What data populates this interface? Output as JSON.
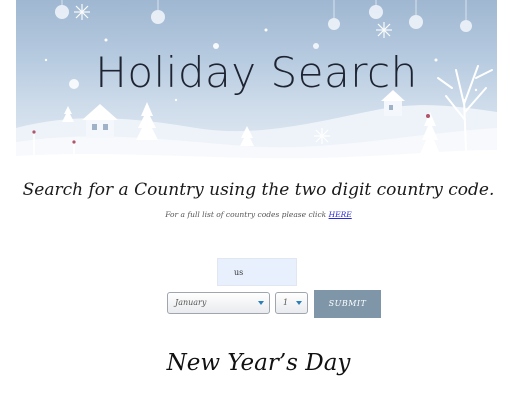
{
  "banner": {
    "title": "Holiday Search"
  },
  "search": {
    "heading": "Search for a Country using the two digit country code.",
    "hint_prefix": "For a full list of country codes please click ",
    "hint_link": "HERE",
    "country_value": "us"
  },
  "controls": {
    "month_selected": "January",
    "day_selected": "1",
    "submit_label": "SUBMIT"
  },
  "result": {
    "holiday_name": "New Year’s Day"
  },
  "colors": {
    "banner_sky": "#9fb7d1",
    "submit_bg": "#7f96a9",
    "input_bg": "#e8f0fd",
    "link": "#2a2ad6"
  }
}
